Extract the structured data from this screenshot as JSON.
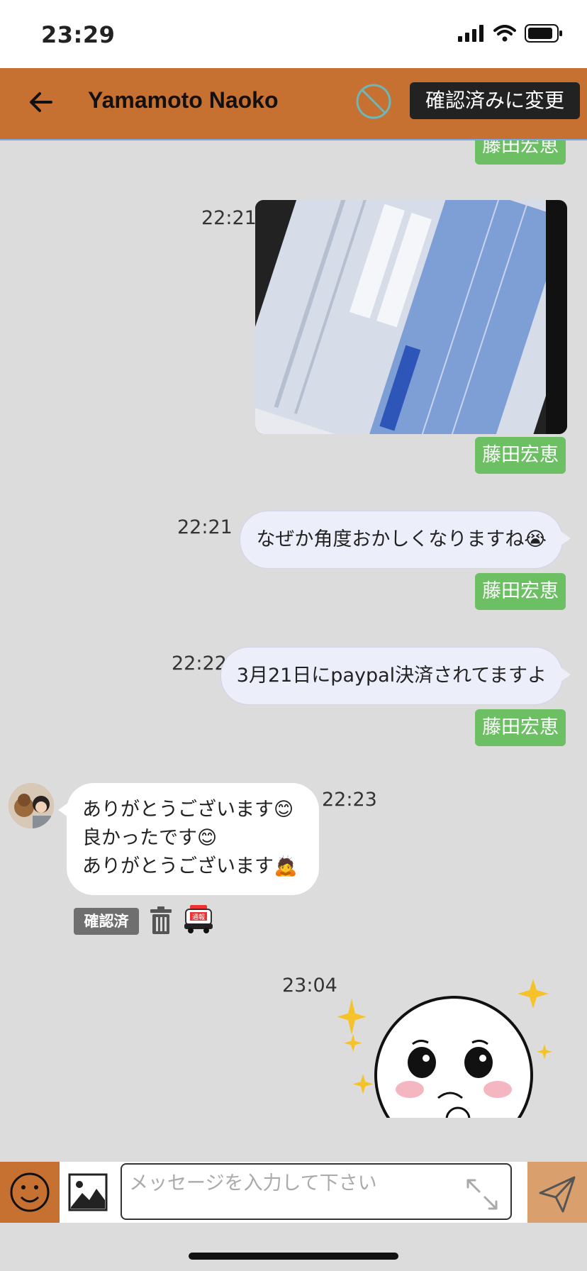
{
  "status": {
    "time": "23:29"
  },
  "header": {
    "contact_name": "Yamamoto Naoko",
    "confirm_label": "確認済みに変更"
  },
  "messages": [
    {
      "direction": "outgoing",
      "sender": "藤田宏恵"
    },
    {
      "direction": "outgoing",
      "type": "image",
      "time": "22:21",
      "sender": "藤田宏恵"
    },
    {
      "direction": "outgoing",
      "type": "text",
      "time": "22:21",
      "text": "なぜか角度おかしくなりますね😭",
      "sender": "藤田宏恵"
    },
    {
      "direction": "outgoing",
      "type": "text",
      "time": "22:22",
      "text": "3月21日にpaypal決済されてますよ",
      "sender": "藤田宏恵"
    },
    {
      "direction": "incoming",
      "type": "text",
      "time": "22:23",
      "lines": [
        "ありがとうございます😊",
        "良かったです😊",
        "ありがとうございます🙇"
      ],
      "badge": "確認済",
      "report_label": "通報"
    },
    {
      "direction": "outgoing",
      "type": "sticker",
      "time": "23:04"
    }
  ],
  "input": {
    "placeholder": "メッセージを入力して下さい"
  },
  "colors": {
    "header": "#c67032",
    "sender_tag": "#6cbf63",
    "send_button": "#d9a06e",
    "chat_bg": "#dcdcdc"
  },
  "icons": [
    "back-arrow-icon",
    "block-icon",
    "trash-icon",
    "police-car-icon",
    "smile-icon",
    "image-icon",
    "expand-icon",
    "send-icon"
  ]
}
